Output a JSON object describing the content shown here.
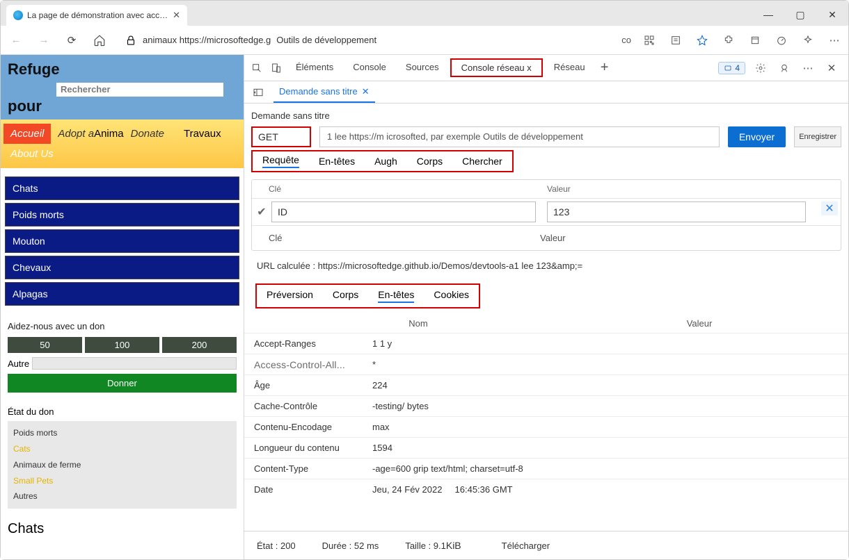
{
  "browser": {
    "tab_title": "La page de démonstration avec accessibilité test",
    "address_prefix": "animaux https://microsoftedge.g",
    "address_suffix": "Outils de développement",
    "co_badge": "co"
  },
  "winbuttons": {
    "min": "—",
    "max": "▢",
    "close": "✕"
  },
  "page": {
    "title_l1": "Refuge",
    "title_l2": "pour",
    "search_ph": "Rechercher",
    "nav": {
      "accueil": "Accueil",
      "adopt": "Adopt a",
      "anima": "Anima",
      "donate": "Donate",
      "travaux": "Travaux",
      "about": "About Us"
    },
    "cats": [
      "Chats",
      "Poids morts",
      "Mouton",
      "Chevaux",
      "Alpagas"
    ],
    "donate": {
      "heading": "Aidez-nous avec un don",
      "amts": [
        "50",
        "100",
        "200"
      ],
      "other": "Autre",
      "give": "Donner"
    },
    "status": {
      "heading": "État du don",
      "rows": [
        "Poids morts",
        "Cats",
        "Animaux de ferme",
        "Small Pets",
        "Autres"
      ]
    },
    "chats": "Chats"
  },
  "devtools": {
    "tabs": {
      "elements": "Éléments",
      "console": "Console",
      "sources": "Sources",
      "netconsole": "Console réseau x",
      "network": "Réseau"
    },
    "issues_count": "4",
    "subtab": "Demande sans titre",
    "request": {
      "title": "Demande sans titre",
      "method": "GET",
      "url": "1 lee https://m icrosofted, par exemple Outils de développement",
      "send": "Envoyer",
      "save": "Enregistrer"
    },
    "reqtabs": [
      "Requête",
      "En-têtes",
      "Augh",
      "Corps",
      "Chercher"
    ],
    "kv": {
      "key_label": "Clé",
      "val_label": "Valeur",
      "key_input": "ID",
      "val_input": "123",
      "key_ph": "Clé",
      "val_ph": "Valeur"
    },
    "calc_url": "URL calculée : https://microsoftedge.github.io/Demos/devtools-a1 lee 123&amp;=",
    "resptabs": [
      "Préversion",
      "Corps",
      "En-têtes",
      "Cookies"
    ],
    "headers": {
      "col_name": "Nom",
      "col_val": "Valeur",
      "rows": [
        {
          "n": "Accept-Ranges",
          "v": "1 1 y"
        },
        {
          "n": "Access-Control-All...",
          "v": "*"
        },
        {
          "n": "Âge",
          "v": "224"
        },
        {
          "n": "Cache-Contrôle",
          "v": "-testing/ bytes"
        },
        {
          "n": "Contenu-Encodage",
          "v": "max"
        },
        {
          "n": "Longueur du contenu",
          "v": "1594"
        },
        {
          "n": "Content-Type",
          "v": "-age=600 grip text/html; charset=utf-8"
        },
        {
          "n": "Date",
          "v": "Jeu, 24 Fév 2022     16:45:36 GMT"
        }
      ]
    },
    "status": {
      "etat": "État : 200",
      "duree": "Durée : 52 ms",
      "taille_pre": "Taille : 9.1",
      "taille_unit": "KiB",
      "download": "Télécharger"
    }
  }
}
